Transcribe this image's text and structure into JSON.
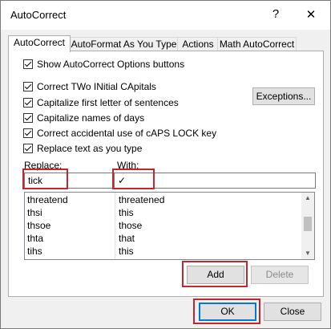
{
  "window": {
    "title": "AutoCorrect",
    "help_glyph": "?",
    "close_glyph": "✕"
  },
  "tabs": [
    {
      "label": "AutoCorrect"
    },
    {
      "label": "AutoFormat As You Type"
    },
    {
      "label": "Actions"
    },
    {
      "label": "Math AutoCorrect"
    }
  ],
  "options": {
    "show_buttons": "Show AutoCorrect Options buttons",
    "two_initial_caps": "Correct TWo INitial CApitals",
    "capitalize_sentences": "Capitalize first letter of sentences",
    "capitalize_days": "Capitalize names of days",
    "caps_lock": "Correct accidental use of cAPS LOCK key",
    "replace_as_type": "Replace text as you type",
    "exceptions_label": "Exceptions..."
  },
  "replace": {
    "label": "Replace:",
    "value": "tick"
  },
  "with": {
    "label": "With:",
    "value": "✓"
  },
  "entries": [
    {
      "replace": "threatend",
      "with": "threatened"
    },
    {
      "replace": "thsi",
      "with": "this"
    },
    {
      "replace": "thsoe",
      "with": "those"
    },
    {
      "replace": "thta",
      "with": "that"
    },
    {
      "replace": "tihs",
      "with": "this"
    }
  ],
  "buttons": {
    "add": "Add",
    "delete": "Delete",
    "ok": "OK",
    "close": "Close"
  },
  "colors": {
    "highlight": "#c1272d",
    "focus": "#0078d7"
  }
}
